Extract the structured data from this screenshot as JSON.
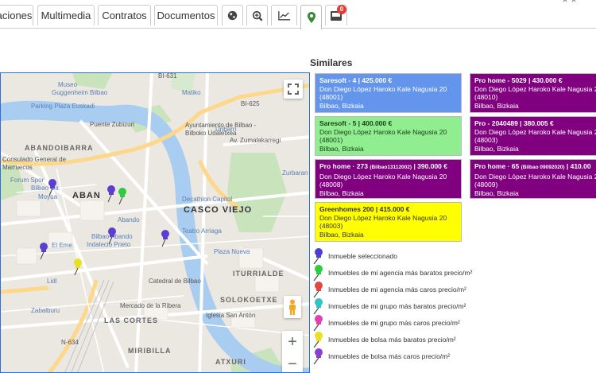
{
  "tabs": [
    {
      "name": "tab-relaciones",
      "label": "aciones"
    },
    {
      "name": "tab-multimedia",
      "label": "Multimedia"
    },
    {
      "name": "tab-contratos",
      "label": "Contratos"
    },
    {
      "name": "tab-documentos",
      "label": "Documentos"
    }
  ],
  "icon_tabs": [
    "globe-icon",
    "zoom-icon",
    "chart-icon",
    "map-marker-icon",
    "inbox-icon"
  ],
  "notification_count": "0",
  "similares": {
    "title": "Similares",
    "cards": [
      {
        "color": "blue",
        "head": "Saresoft - 4 | 425.000 €",
        "head_small": "",
        "address": "Don Diego López Haroko Kale Nagusia 20",
        "postcode": "(48001)",
        "city": "Bilbao, Bizkaia"
      },
      {
        "color": "purple",
        "head": "Pro home - 5029 | 430.000 €",
        "head_small": "",
        "address": "Don Diego López Haroko Kale Nagusia 20",
        "postcode": "(48010)",
        "city": "Bilbao, Bizkaia"
      },
      {
        "color": "green",
        "head": "Saresoft - 5 | 400.000 €",
        "head_small": "",
        "address": "Don Diego López Haroko Kale Nagusia 20",
        "postcode": "(48001)",
        "city": "Bilbao, Bizkaia"
      },
      {
        "color": "purple",
        "head": "Pro - 2040489 | 380.005 €",
        "head_small": "",
        "address": "Don Diego López Haroko Kale Nagusia 20",
        "postcode": "(48003)",
        "city": "Bilbao, Bizkaia"
      },
      {
        "color": "purple",
        "head": "Pro home · 273 ",
        "head_small": "(Bilbao13112002)",
        "head_tail": " | 390.000 €",
        "address": "Don Diego López Haroko Kale Nagusia 20",
        "postcode": "(48008)",
        "city": "Bilbao, Bizkaia"
      },
      {
        "color": "purple",
        "head": "Pro home · 65 ",
        "head_small": "(Bilbao 09092020)",
        "head_tail": " | 410.00",
        "address": "Don Diego López Haroko Kale Nagusia 20",
        "postcode": "(48009)",
        "city": "Bilbao, Bizkaia"
      },
      {
        "color": "yellow",
        "head": "Greenhomes 200 | 415.000 €",
        "head_small": "",
        "address": "Don Diego López Haroko Kale Nagusia 20",
        "postcode": "(48003)",
        "city": "Bilbao, Bizkaia"
      }
    ]
  },
  "legend": [
    {
      "label": "Inmueble seleccionado",
      "color": "#4b3fd1"
    },
    {
      "label": "Inmuebles de mi agencia más baratos precio/m²",
      "color": "#2ecc40"
    },
    {
      "label": "Inmuebles de mi agencia más caros precio/m²",
      "color": "#e04848"
    },
    {
      "label": "Inmuebles de mi grupo más baratos precio/m²",
      "color": "#2ec4c4"
    },
    {
      "label": "Inmuebles de mi grupo más caros precio/m²",
      "color": "#e040b0"
    },
    {
      "label": "Inmuebles de bolsa más baratos precio/m²",
      "color": "#e8e020"
    },
    {
      "label": "Inmuebles de bolsa más caros precio/m²",
      "color": "#8a3fd1"
    }
  ],
  "map": {
    "labels": [
      {
        "text": "Museo",
        "cls": "poi"
      },
      {
        "text": "Guggenheim Bilbao",
        "cls": "poi"
      },
      {
        "text": "Parking Plaza Euskadi",
        "cls": "poi"
      },
      {
        "text": "Puente Zubizuri",
        "cls": ""
      },
      {
        "text": "ABANDOIBARRA",
        "cls": "big"
      },
      {
        "text": "Consulado General de",
        "cls": ""
      },
      {
        "text": "Marruecos",
        "cls": ""
      },
      {
        "text": "Ayuntamiento de Bilbao -",
        "cls": ""
      },
      {
        "text": "Bilboko Udaletxea",
        "cls": ""
      },
      {
        "text": "Uribarri",
        "cls": "poi"
      },
      {
        "text": "Matiko",
        "cls": "poi"
      },
      {
        "text": "Zurbaran",
        "cls": "poi"
      },
      {
        "text": "Forum Spor",
        "cls": "poi"
      },
      {
        "text": "Bilbao Ca",
        "cls": "poi"
      },
      {
        "text": "Moyua",
        "cls": "poi"
      },
      {
        "text": "ABAN",
        "cls": "dark"
      },
      {
        "text": "Decathlon Capitol",
        "cls": "poi"
      },
      {
        "text": "CASCO VIEJO",
        "cls": "dark"
      },
      {
        "text": "Abando",
        "cls": "poi"
      },
      {
        "text": "Teatro Arriaga",
        "cls": "poi"
      },
      {
        "text": "Bilbao Abando",
        "cls": "poi"
      },
      {
        "text": "Indalecio Prieto",
        "cls": "poi"
      },
      {
        "text": "Plaza Nueva",
        "cls": "poi"
      },
      {
        "text": "El Eme",
        "cls": "poi"
      },
      {
        "text": "ITURRIALDE",
        "cls": "big"
      },
      {
        "text": "Lidl",
        "cls": "poi"
      },
      {
        "text": "Catedral de Bilbao",
        "cls": ""
      },
      {
        "text": "SOLOKOETXE",
        "cls": "big"
      },
      {
        "text": "Zabalburu",
        "cls": "poi"
      },
      {
        "text": "Mercado de la Ribera",
        "cls": ""
      },
      {
        "text": "LAS CORTES",
        "cls": "big"
      },
      {
        "text": "Iglesia San Antón",
        "cls": ""
      },
      {
        "text": "MIRIBILLA",
        "cls": "big"
      },
      {
        "text": "ATXURI",
        "cls": "big"
      },
      {
        "text": "BI-625",
        "cls": ""
      },
      {
        "text": "BI-631",
        "cls": ""
      },
      {
        "text": "N-634",
        "cls": ""
      },
      {
        "text": "Av. Zumalakarregi",
        "cls": ""
      }
    ]
  }
}
